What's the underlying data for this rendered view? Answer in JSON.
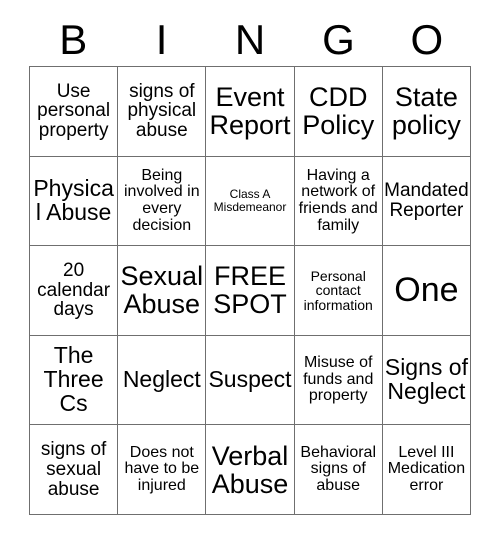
{
  "header": {
    "letters": [
      "B",
      "I",
      "N",
      "G",
      "O"
    ]
  },
  "grid": {
    "columns": 5,
    "rows": 5,
    "border_color": "#6f6f6f",
    "background_color": "#ffffff",
    "text_color": "#000000",
    "cells": [
      [
        {
          "text": "Use personal property",
          "size": "fs-l"
        },
        {
          "text": "signs of physical abuse",
          "size": "fs-l"
        },
        {
          "text": "Event Report",
          "size": "fs-xxl"
        },
        {
          "text": "CDD Policy",
          "size": "fs-xxl"
        },
        {
          "text": "State policy",
          "size": "fs-xxl"
        }
      ],
      [
        {
          "text": "Physical Abuse",
          "size": "fs-xl"
        },
        {
          "text": "Being involved in every decision",
          "size": "fs-m"
        },
        {
          "text": "Class A Misdemeanor",
          "size": "fs-xs"
        },
        {
          "text": "Having a network of friends and family",
          "size": "fs-m"
        },
        {
          "text": "Mandated Reporter",
          "size": "fs-l"
        }
      ],
      [
        {
          "text": "20 calendar days",
          "size": "fs-l"
        },
        {
          "text": "Sexual Abuse",
          "size": "fs-xxl"
        },
        {
          "text": "FREE SPOT",
          "size": "fs-xxl"
        },
        {
          "text": "Personal contact information",
          "size": "fs-s"
        },
        {
          "text": "One",
          "size": "fs-huge"
        }
      ],
      [
        {
          "text": "The Three Cs",
          "size": "fs-xl"
        },
        {
          "text": "Neglect",
          "size": "fs-xl"
        },
        {
          "text": "Suspect",
          "size": "fs-xl"
        },
        {
          "text": "Misuse of funds and property",
          "size": "fs-m"
        },
        {
          "text": "Signs of Neglect",
          "size": "fs-xl"
        }
      ],
      [
        {
          "text": "signs of sexual abuse",
          "size": "fs-l"
        },
        {
          "text": "Does not have to be injured",
          "size": "fs-m"
        },
        {
          "text": "Verbal Abuse",
          "size": "fs-xxl"
        },
        {
          "text": "Behavioral signs of abuse",
          "size": "fs-m"
        },
        {
          "text": "Level III Medication error",
          "size": "fs-m"
        }
      ]
    ]
  }
}
